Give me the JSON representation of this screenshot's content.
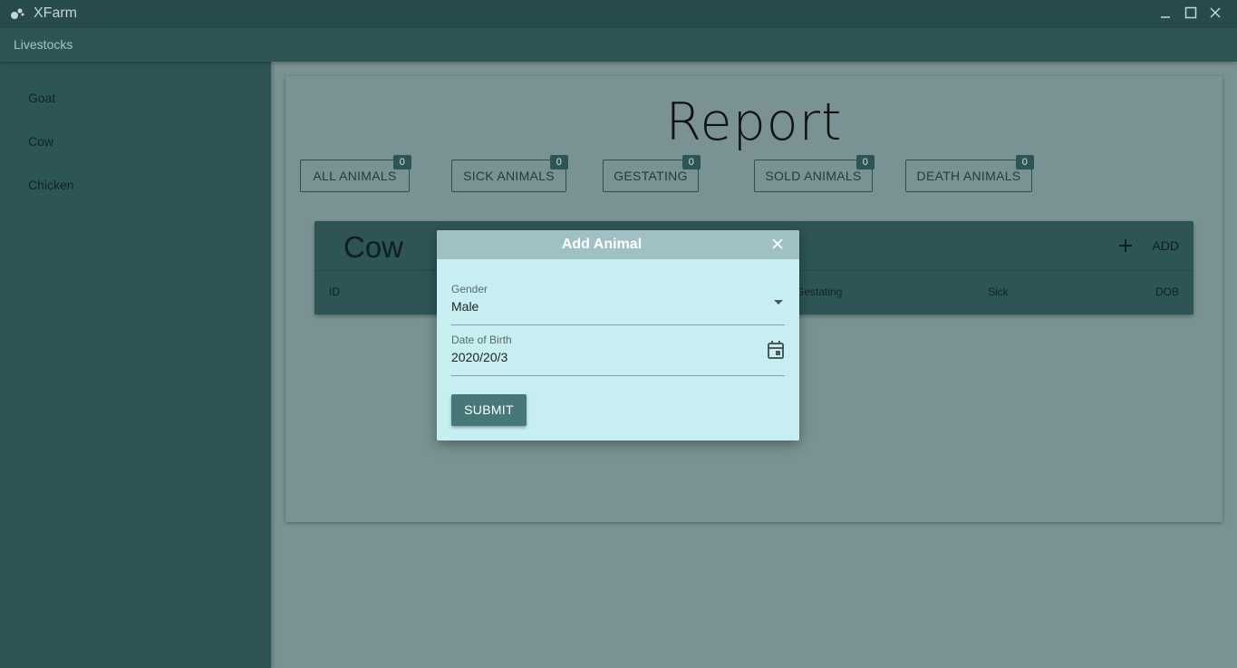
{
  "window": {
    "title": "XFarm"
  },
  "appbar": {
    "title": "Livestocks"
  },
  "sidebar": {
    "items": [
      {
        "label": "Goat"
      },
      {
        "label": "Cow"
      },
      {
        "label": "Chicken"
      }
    ]
  },
  "report": {
    "title": "Report",
    "stats": [
      {
        "label": "ALL ANIMALS",
        "count": "0"
      },
      {
        "label": "SICK ANIMALS",
        "count": "0"
      },
      {
        "label": "GESTATING",
        "count": "0"
      },
      {
        "label": "SOLD ANIMALS",
        "count": "0"
      },
      {
        "label": "DEATH ANIMALS",
        "count": "0"
      }
    ]
  },
  "table": {
    "title": "Cow",
    "add_label": "ADD",
    "columns": [
      "ID",
      "Gestating",
      "Sick",
      "DOB"
    ]
  },
  "modal": {
    "title": "Add Animal",
    "gender_label": "Gender",
    "gender_value": "Male",
    "dob_label": "Date of Birth",
    "dob_value": "2020/20/3",
    "submit_label": "SUBMIT"
  },
  "colors": {
    "titlebar": "#274b4b",
    "sidebar": "#2d5555",
    "overlay": "#7a9293",
    "modal_bg": "#c7eff1",
    "modal_header": "#9fc1c3",
    "submit_button": "#467878"
  }
}
